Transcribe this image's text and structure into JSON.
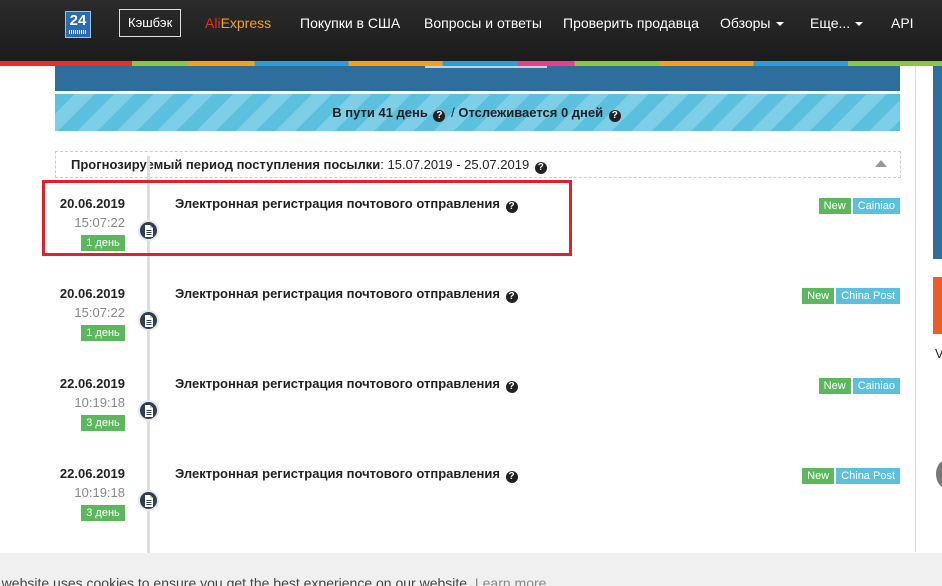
{
  "nav": {
    "logo_text": "24",
    "cashback": "Кэшбэк",
    "ali_part1": "Ali",
    "ali_part2": "Express",
    "items": [
      "Покупки в США",
      "Вопросы и ответы",
      "Проверить продавца",
      "Обзоры",
      "Еще...",
      "API"
    ]
  },
  "status": {
    "in_transit_label": "В пути 41 день",
    "separator": " / ",
    "tracking_label": "Отслеживается 0 дней"
  },
  "forecast": {
    "label": "Прогнозируемый период поступления посылки",
    "colon": ":",
    "period": "15.07.2019 - 25.07.2019"
  },
  "events": [
    {
      "date": "20.06.2019",
      "time": "15:07:22",
      "days": "1 день",
      "title": "Электронная регистрация почтового отправления",
      "badge_new": "New",
      "source": "Cainiao"
    },
    {
      "date": "20.06.2019",
      "time": "15:07:22",
      "days": "1 день",
      "title": "Электронная регистрация почтового отправления",
      "badge_new": "New",
      "source": "China Post"
    },
    {
      "date": "22.06.2019",
      "time": "10:19:18",
      "days": "3 день",
      "title": "Электронная регистрация почтового отправления",
      "badge_new": "New",
      "source": "Cainiao"
    },
    {
      "date": "22.06.2019",
      "time": "10:19:18",
      "days": "3 день",
      "title": "Электронная регистрация почтового отправления",
      "badge_new": "New",
      "source": "China Post"
    }
  ],
  "cookie": {
    "text": "e website uses cookies to ensure you get the best experience on our website.",
    "link": "Learn more"
  },
  "side": {
    "char": "V"
  },
  "colors": {
    "nav_bg": "#1c1c1c",
    "success": "#5cb85c",
    "info": "#5bc0de",
    "primary_dark": "#2e6e9c",
    "highlight": "#e0202a"
  },
  "icons": {
    "question": "question-circle-icon",
    "document": "document-icon",
    "caret": "caret-down-icon",
    "collapse": "chevron-up-icon"
  }
}
